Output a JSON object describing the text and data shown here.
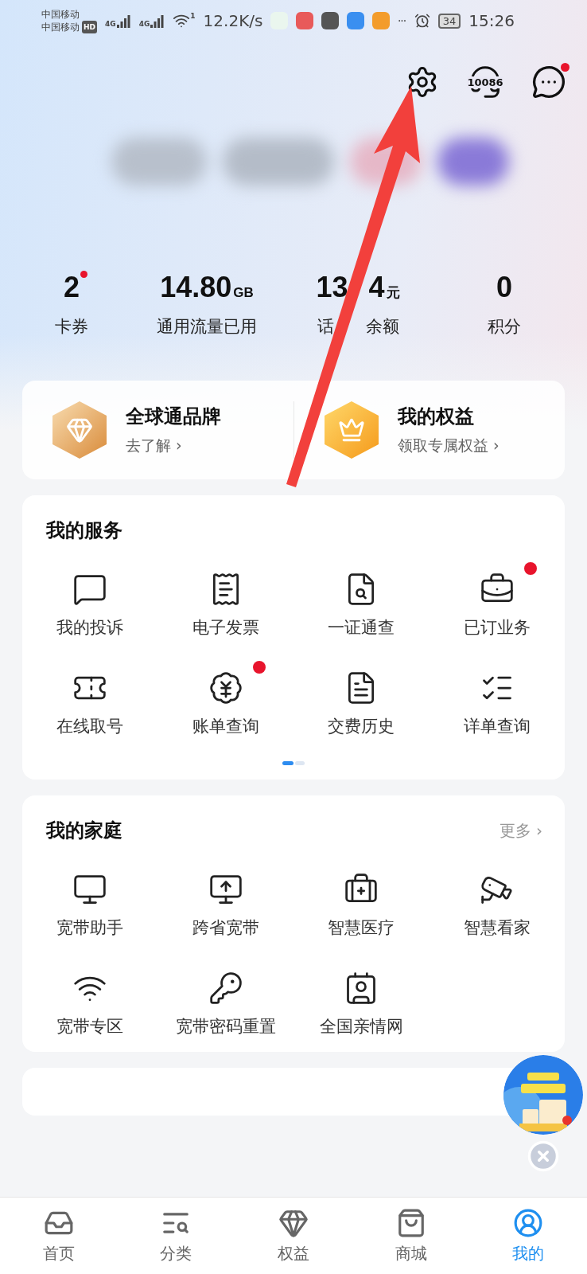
{
  "status_bar": {
    "carriers": [
      {
        "name": "中国移动"
      },
      {
        "name": "中国移动",
        "tag": "HD"
      }
    ],
    "network_types": [
      "4G",
      "4G"
    ],
    "hotspot_count": "1",
    "speed": "12.2K/s",
    "more": "···",
    "battery": "34",
    "time": "15:26"
  },
  "header": {
    "message_badge": true,
    "hotline": "10086"
  },
  "stats": [
    {
      "value": "2",
      "label": "卡券",
      "badge": true
    },
    {
      "value": "14.80",
      "unit": "GB",
      "label": "通用流量已用",
      "badge": false
    },
    {
      "value": "13",
      "value_tail": "4",
      "unit": "元",
      "label": "话",
      "label_tail": "余额",
      "badge": false
    },
    {
      "value": "0",
      "label": "积分",
      "badge": false
    }
  ],
  "promos": [
    {
      "title": "全球通品牌",
      "subtitle": "去了解",
      "arrow": "›"
    },
    {
      "title": "我的权益",
      "subtitle": "领取专属权益",
      "arrow": "›"
    }
  ],
  "services": {
    "title": "我的服务",
    "items": [
      {
        "label": "我的投诉",
        "badge": false
      },
      {
        "label": "电子发票",
        "badge": false
      },
      {
        "label": "一证通查",
        "badge": false
      },
      {
        "label": "已订业务",
        "badge": true
      },
      {
        "label": "在线取号",
        "badge": false
      },
      {
        "label": "账单查询",
        "badge": true
      },
      {
        "label": "交费历史",
        "badge": false
      },
      {
        "label": "详单查询",
        "badge": false
      }
    ],
    "page_dots": [
      {
        "selected": true
      },
      {
        "selected": false
      }
    ]
  },
  "family": {
    "title": "我的家庭",
    "more": "更多",
    "more_arrow": "›",
    "items": [
      {
        "label": "宽带助手"
      },
      {
        "label": "跨省宽带"
      },
      {
        "label": "智慧医疗"
      },
      {
        "label": "智慧看家"
      },
      {
        "label": "宽带专区"
      },
      {
        "label": "宽带密码重置"
      },
      {
        "label": "全国亲情网"
      }
    ]
  },
  "bottom_nav": [
    {
      "label": "首页",
      "selected": false
    },
    {
      "label": "分类",
      "selected": false
    },
    {
      "label": "权益",
      "selected": false
    },
    {
      "label": "商城",
      "selected": false
    },
    {
      "label": "我的",
      "selected": true
    }
  ]
}
